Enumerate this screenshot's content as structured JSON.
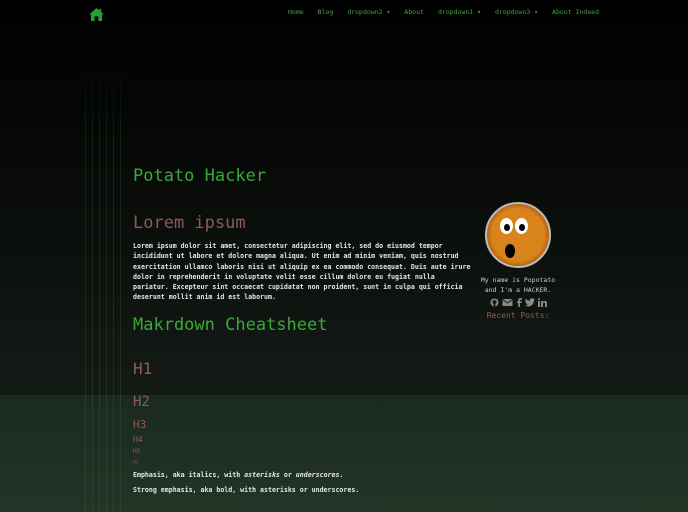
{
  "nav": {
    "items": [
      "Home",
      "Blog",
      "dropdown2 ▾",
      "About",
      "dropdown1 ▾",
      "dropdown3 ▾",
      "About Indeed"
    ]
  },
  "main": {
    "site_title": "Potato Hacker",
    "lorem_heading": "Lorem ipsum",
    "lorem_text": "Lorem ipsum dolor sit amet, consectetur adipiscing elit, sed do eiusmod tempor incididunt ut labore et dolore magna aliqua. Ut enim ad minim veniam, quis nostrud exercitation ullamco laboris nisi ut aliquip ex ea commodo consequat. Duis aute irure dolor in reprehenderit in voluptate velit esse cillum dolore eu fugiat nulla pariatur. Excepteur sint occaecat cupidatat non proident, sunt in culpa qui officia deserunt mollit anim id est laborum.",
    "cheatsheet_heading": "Makrdown Cheatsheet",
    "h1": "H1",
    "h2": "H2",
    "h3": "H3",
    "h4": "H4",
    "h5": "H5",
    "h6": "H6",
    "emphasis_prefix": "Emphasis, aka italics, with ",
    "emphasis_a": "asterisks",
    "emphasis_or": " or ",
    "emphasis_b": "underscores",
    "emphasis_end": ".",
    "strong": "Strong emphasis, aka bold, with asterisks or underscores."
  },
  "sidebar": {
    "bio": "My name is Popotato and I'm a HACKER.",
    "recent_posts": "Recent Posts:"
  }
}
